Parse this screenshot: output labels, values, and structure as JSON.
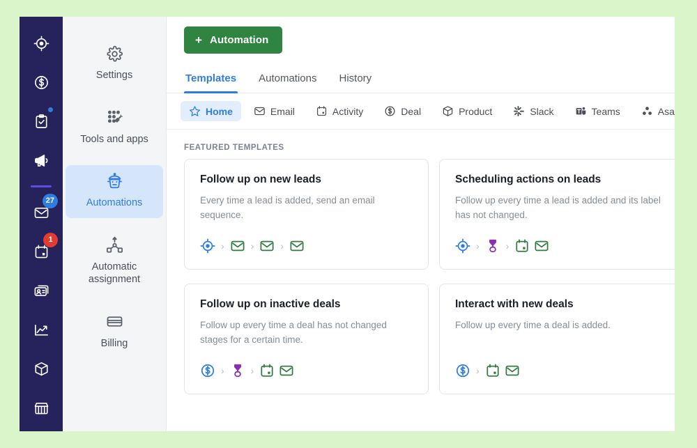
{
  "theme": {
    "page_background": "#d9f5c9",
    "rail_background": "#26225c",
    "nav_background": "#f4f5f7",
    "accent_blue": "#2f7de1",
    "accent_green": "#2f8442",
    "badge_blue": "#2f7de1",
    "badge_red": "#e03c31",
    "divider_purple": "#5b4fe0",
    "flow_green": "#2f7a3e",
    "flow_purple": "#8b2fb0"
  },
  "rail": {
    "items": [
      {
        "icon": "target-icon",
        "name": "rail-item-target",
        "badge": null,
        "badge_color": null,
        "dot": false
      },
      {
        "icon": "dollar-circle-icon",
        "name": "rail-item-deals",
        "badge": null,
        "badge_color": null,
        "dot": false
      },
      {
        "icon": "clipboard-check-icon",
        "name": "rail-item-tasks",
        "badge": null,
        "badge_color": null,
        "dot": true
      },
      {
        "icon": "megaphone-icon",
        "name": "rail-item-campaigns",
        "badge": null,
        "badge_color": null,
        "dot": false
      },
      {
        "icon": "envelope-icon",
        "name": "rail-item-inbox",
        "badge": "27",
        "badge_color": "blue",
        "dot": false
      },
      {
        "icon": "calendar-icon",
        "name": "rail-item-calendar",
        "badge": "1",
        "badge_color": "red",
        "dot": false
      },
      {
        "icon": "contact-card-icon",
        "name": "rail-item-contacts",
        "badge": null,
        "badge_color": null,
        "dot": false
      },
      {
        "icon": "chart-trend-icon",
        "name": "rail-item-reports",
        "badge": null,
        "badge_color": null,
        "dot": false
      },
      {
        "icon": "box-icon",
        "name": "rail-item-products",
        "badge": null,
        "badge_color": null,
        "dot": false
      },
      {
        "icon": "storefront-icon",
        "name": "rail-item-store",
        "badge": null,
        "badge_color": null,
        "dot": false
      }
    ]
  },
  "nav": {
    "items": [
      {
        "label": "Settings",
        "icon": "gear-icon",
        "active": false
      },
      {
        "label": "Tools and apps",
        "icon": "tools-apps-icon",
        "active": false
      },
      {
        "label": "Automations",
        "icon": "robot-icon",
        "active": true
      },
      {
        "label": "Automatic assignment",
        "icon": "assignment-icon",
        "active": false
      },
      {
        "label": "Billing",
        "icon": "credit-card-icon",
        "active": false
      }
    ]
  },
  "toolbar": {
    "create_label": "Automation",
    "create_plus": "+"
  },
  "tabs": [
    {
      "label": "Templates",
      "active": true
    },
    {
      "label": "Automations",
      "active": false
    },
    {
      "label": "History",
      "active": false
    }
  ],
  "chips": [
    {
      "label": "Home",
      "icon": "star-icon",
      "active": true
    },
    {
      "label": "Email",
      "icon": "envelope-icon",
      "active": false
    },
    {
      "label": "Activity",
      "icon": "calendar-icon",
      "active": false
    },
    {
      "label": "Deal",
      "icon": "dollar-circle-icon",
      "active": false
    },
    {
      "label": "Product",
      "icon": "box-icon",
      "active": false
    },
    {
      "label": "Slack",
      "icon": "slack-icon",
      "active": false
    },
    {
      "label": "Teams",
      "icon": "teams-icon",
      "active": false
    },
    {
      "label": "Asana",
      "icon": "asana-icon",
      "active": false
    }
  ],
  "section": {
    "featured_label": "FEATURED TEMPLATES"
  },
  "cards": [
    {
      "title": "Follow up on new leads",
      "description": "Every time a lead is added, send an email sequence.",
      "flow": [
        "target-icon",
        "arrow",
        "envelope-icon",
        "arrow",
        "envelope-icon",
        "arrow",
        "envelope-icon"
      ]
    },
    {
      "title": "Scheduling actions on leads",
      "description": "Follow up every time a lead is added and its label has not changed.",
      "flow": [
        "target-icon",
        "arrow",
        "hourglass-icon",
        "arrow",
        "calendar-icon",
        "envelope-icon"
      ]
    },
    {
      "title": "Follow up on inactive deals",
      "description": "Follow up every time a deal has not changed stages for a certain time.",
      "flow": [
        "dollar-circle-icon",
        "arrow",
        "hourglass-icon",
        "arrow",
        "calendar-icon",
        "envelope-icon"
      ]
    },
    {
      "title": "Interact with new deals",
      "description": "Follow up every time a deal is added.",
      "flow": [
        "dollar-circle-icon",
        "arrow",
        "calendar-icon",
        "envelope-icon"
      ]
    }
  ]
}
